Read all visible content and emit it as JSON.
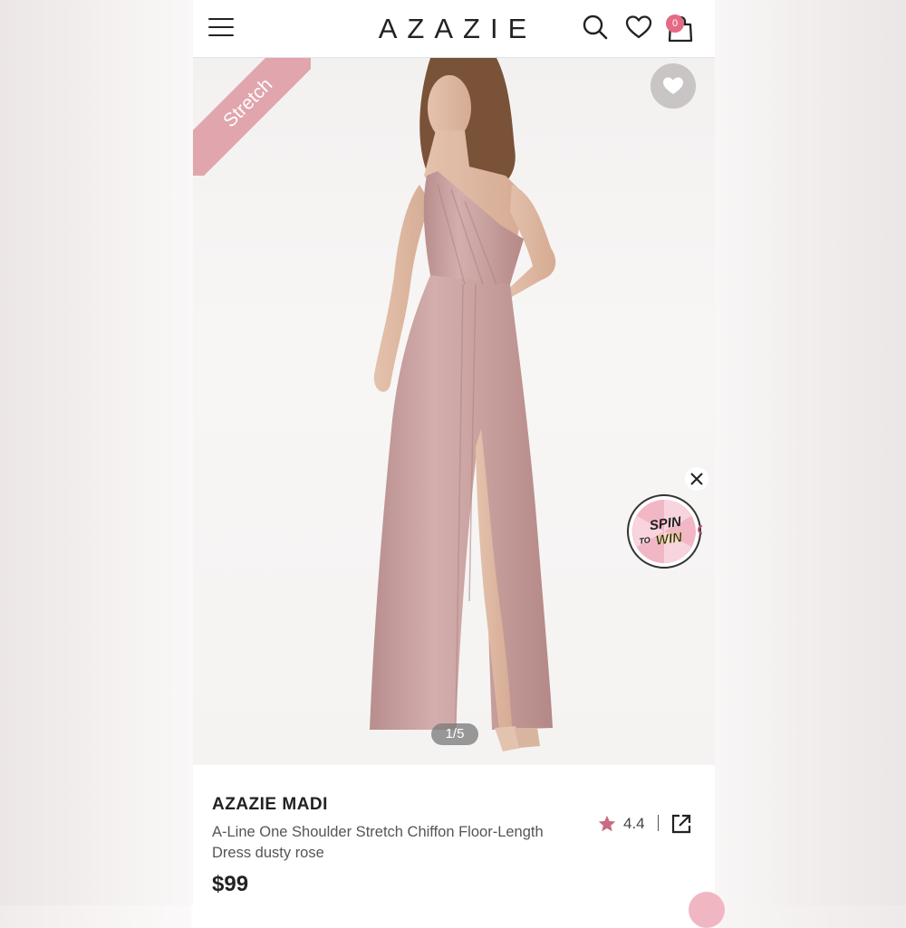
{
  "header": {
    "logo": "AZAZIE",
    "cart_count": "0"
  },
  "hero": {
    "ribbon": "Stretch",
    "image_counter": "1/5",
    "spin_line1": "SPIN",
    "spin_to": "TO",
    "spin_line2": "WIN"
  },
  "product": {
    "name": "AZAZIE MADI",
    "description": "A-Line One Shoulder Stretch Chiffon Floor-Length Dress dusty rose",
    "rating": "4.4",
    "price": "$99"
  },
  "colors": {
    "accent_pink": "#e46a86",
    "ribbon": "#e0a5ad",
    "dress": "#c9a2a0",
    "rating_star": "#c76a82"
  }
}
